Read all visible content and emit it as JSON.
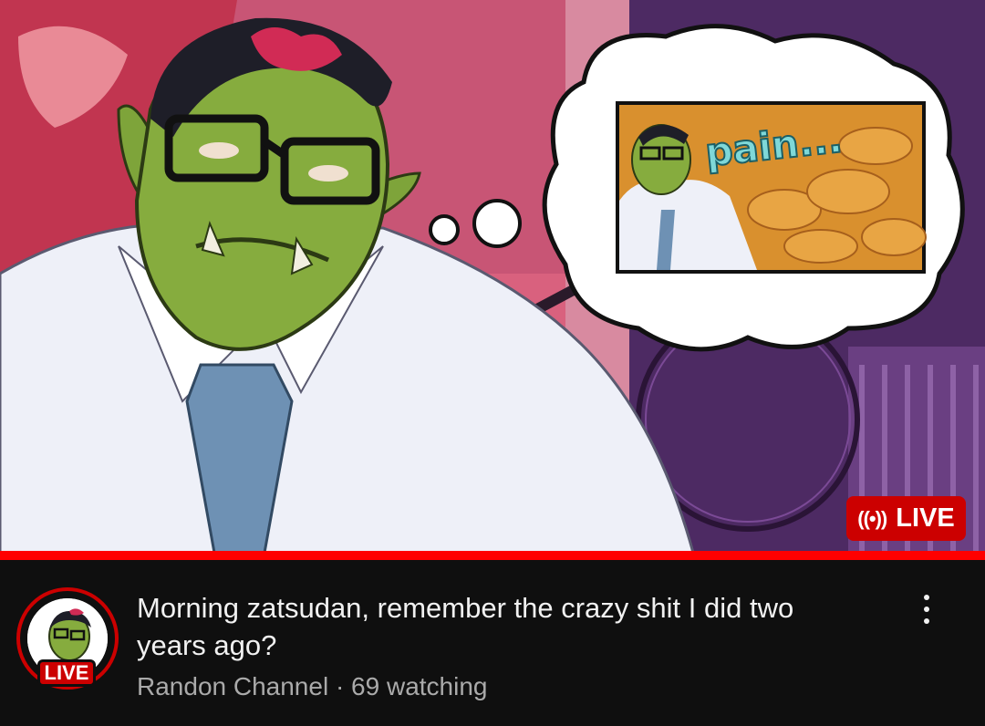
{
  "video": {
    "thumbnail": {
      "thought_bubble_text": "pain...",
      "live_badge_label": "LIVE",
      "live_icon": "broadcast-icon",
      "live_icon_glyph": "((•))"
    },
    "progress_fraction": 1.0,
    "channel_avatar": {
      "live_label": "LIVE"
    },
    "title": "Morning zatsudan, remember the crazy shit I did two years ago?",
    "meta": "Randon Channel · 69 watching",
    "more_icon": "more-vert-icon"
  },
  "colors": {
    "background": "#0f0f0f",
    "live_red": "#cc0000",
    "progress_red": "#ff0000",
    "title_text": "#f1f1f1",
    "meta_text": "#aaaaaa"
  }
}
